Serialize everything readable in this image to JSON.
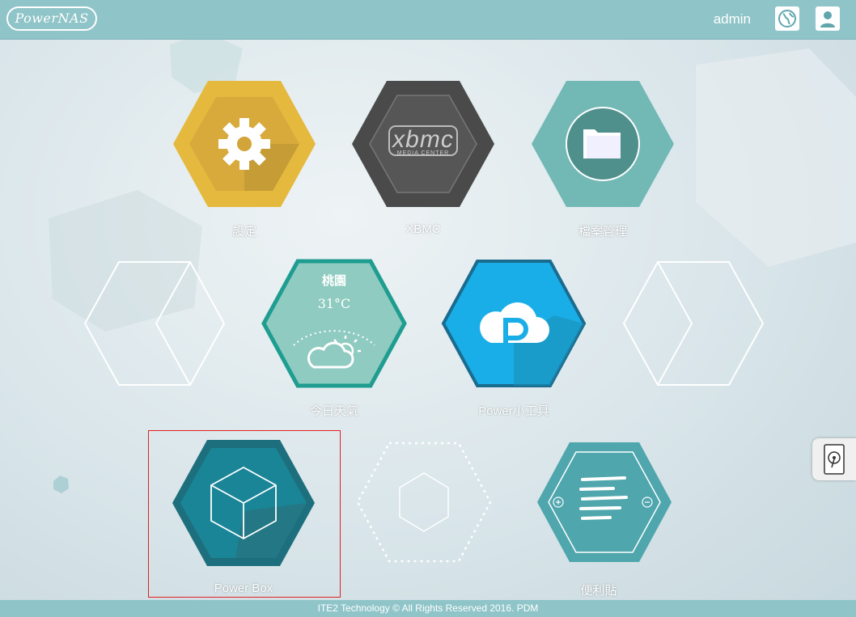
{
  "header": {
    "logo_text": "PowerNAS",
    "username": "admin",
    "icons": [
      "globe-icon",
      "user-icon"
    ]
  },
  "apps": [
    {
      "id": "settings",
      "label": "設定",
      "icon": "gear-icon",
      "color": "#e5b93e"
    },
    {
      "id": "xbmc",
      "label": "XBMC",
      "icon": "xbmc-logo",
      "logo_text": "xbmc",
      "logo_subtext": "MEDIA CENTER",
      "color": "#4a4a4a"
    },
    {
      "id": "file-manager",
      "label": "檔案管理",
      "icon": "folder-icon",
      "color": "#6fb8b4"
    },
    {
      "id": "weather",
      "label": "今日天氣",
      "city": "桃園",
      "temperature": "31°C",
      "icon": "partly-cloudy-icon",
      "color": "#8fc9bf"
    },
    {
      "id": "power-tools",
      "label": "Power小工具",
      "icon": "cloud-p-icon",
      "color": "#1aaee8"
    },
    {
      "id": "power-box",
      "label": "Power Box",
      "icon": "cube-icon",
      "color": "#1d7f8e"
    },
    {
      "id": "empty-slot",
      "label": "",
      "icon": "hexagon-outline-icon"
    },
    {
      "id": "notes",
      "label": "便利貼",
      "icon": "notes-icon",
      "color": "#4fa6ad"
    }
  ],
  "nav": {
    "prev_icon": "chevron-left-icon",
    "next_icon": "chevron-right-icon"
  },
  "side_tab": {
    "icon": "hard-drive-icon"
  },
  "footer": {
    "text": "ITE2 Technology © All Rights Reserved 2016. PDM"
  }
}
